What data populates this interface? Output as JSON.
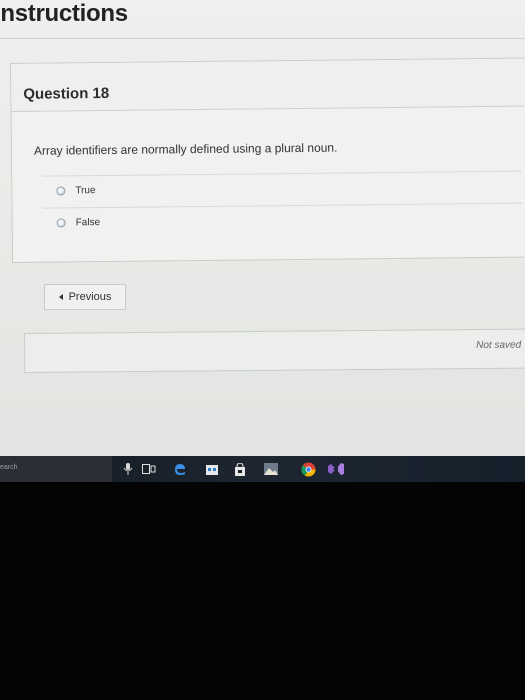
{
  "header": {
    "title": "Instructions"
  },
  "question": {
    "title": "Question 18",
    "text": "Array identifiers are normally defined using a plural noun.",
    "choices": [
      {
        "label": "True"
      },
      {
        "label": "False"
      }
    ]
  },
  "navigation": {
    "previous_label": "Previous"
  },
  "status": {
    "save_text": "Not saved"
  },
  "taskbar": {
    "search_text": "earch",
    "icons": [
      "microphone-icon",
      "task-view-icon",
      "edge-icon",
      "store-icon",
      "shopping-bag-icon",
      "photos-icon",
      "chrome-icon",
      "visual-studio-icon"
    ]
  },
  "colors": {
    "edge": "#3a8ee6",
    "chrome_red": "#db4437",
    "chrome_green": "#0f9d58",
    "chrome_yellow": "#f4b400",
    "vs_purple": "#8c5cc7",
    "taskbar": "#1d2631"
  }
}
